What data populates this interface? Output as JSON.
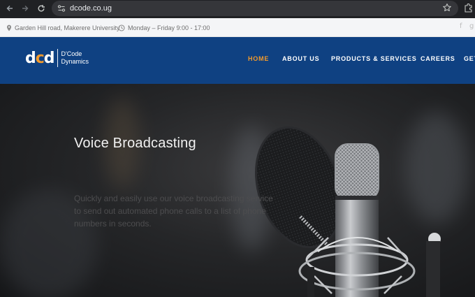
{
  "browser": {
    "url": "dcode.co.ug",
    "icons": [
      "back-icon",
      "forward-icon",
      "reload-icon",
      "site-info-icon",
      "star-icon",
      "extensions-icon"
    ]
  },
  "topbar": {
    "address": "Garden Hill road, Makerere University",
    "hours": "Monday – Friday 9:00 - 17:00",
    "social": [
      "f",
      "g"
    ]
  },
  "header": {
    "logo_mark_d1": "d",
    "logo_mark_c": "c",
    "logo_mark_d2": "d",
    "logo_line1": "D'Code",
    "logo_line2": "Dynamics",
    "menu": [
      {
        "label": "HOME",
        "active": true
      },
      {
        "label": "ABOUT US",
        "active": false
      },
      {
        "label": "PRODUCTS & SERVICES",
        "active": false
      },
      {
        "label": "CAREERS",
        "active": false
      },
      {
        "label": "GET",
        "active": false
      }
    ]
  },
  "hero": {
    "title": "Voice Broadcasting",
    "text": "Quickly and easily use our voice broadcasting service to send out automated phone calls to a list of phone numbers in seconds."
  },
  "colors": {
    "header_bg": "#0f4182",
    "accent": "#f39a2b",
    "topbar_bg": "#f4f5f7",
    "chrome_bg": "#202124"
  }
}
